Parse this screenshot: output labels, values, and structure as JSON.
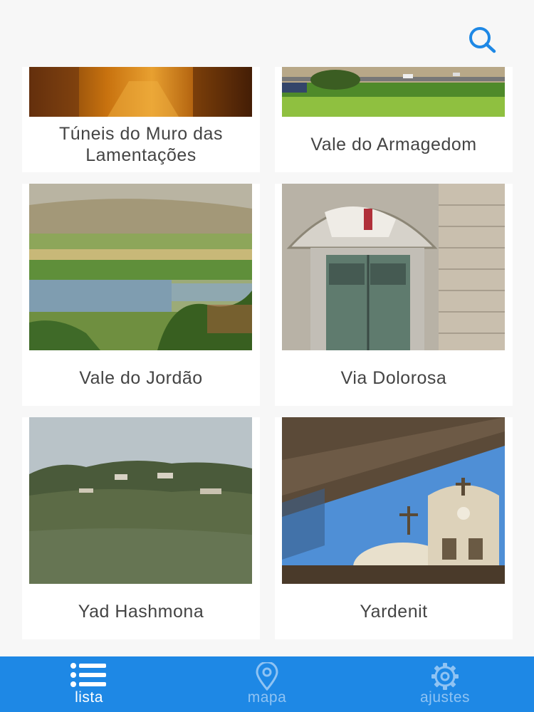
{
  "header": {
    "search_icon": "search-icon"
  },
  "places": [
    {
      "title_line1": "Túneis do Muro das",
      "title_line2": "Lamentações"
    },
    {
      "title": "Vale do Armagedom"
    },
    {
      "title": "Vale do Jordão"
    },
    {
      "title": "Via Dolorosa"
    },
    {
      "title": "Yad Hashmona"
    },
    {
      "title": "Yardenit"
    }
  ],
  "tabs": [
    {
      "label": "lista",
      "icon": "list-icon",
      "active": true
    },
    {
      "label": "mapa",
      "icon": "map-pin-icon",
      "active": false
    },
    {
      "label": "ajustes",
      "icon": "gear-icon",
      "active": false
    }
  ],
  "colors": {
    "accent": "#1e88e5",
    "inactive_tab": "#8fc3f3",
    "text": "#444444"
  }
}
